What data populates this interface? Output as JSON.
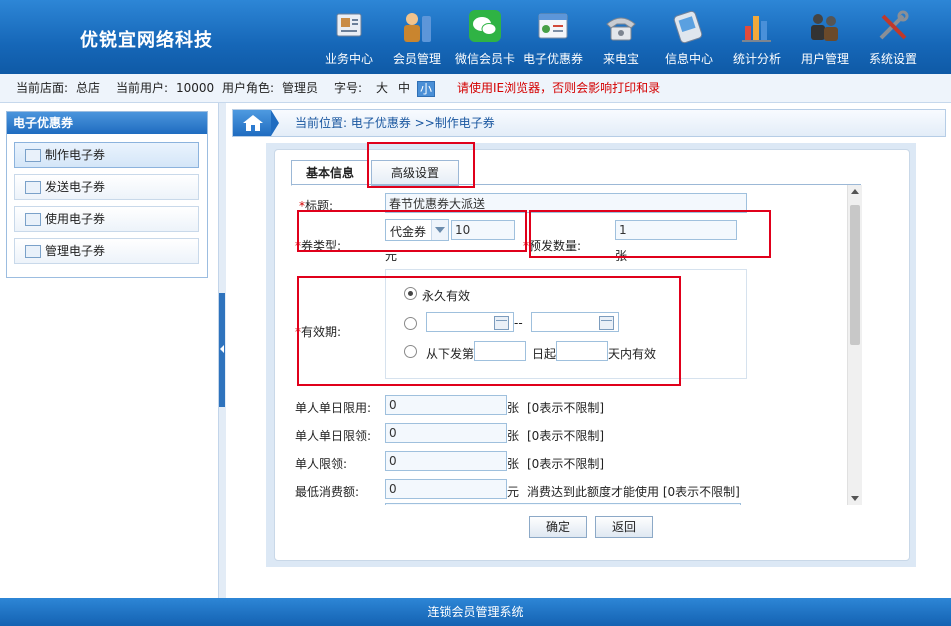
{
  "header": {
    "brand": "优锐宜网络科技",
    "nav": [
      {
        "label": "业务中心",
        "icon": "business-center-icon"
      },
      {
        "label": "会员管理",
        "icon": "member-management-icon"
      },
      {
        "label": "微信会员卡",
        "icon": "wechat-icon"
      },
      {
        "label": "电子优惠券",
        "icon": "coupon-icon"
      },
      {
        "label": "来电宝",
        "icon": "phone-icon"
      },
      {
        "label": "信息中心",
        "icon": "info-center-icon"
      },
      {
        "label": "统计分析",
        "icon": "statistics-icon"
      },
      {
        "label": "用户管理",
        "icon": "user-management-icon"
      },
      {
        "label": "系统设置",
        "icon": "system-settings-icon"
      }
    ]
  },
  "infobar": {
    "store_label": "当前店面:",
    "store_value": "总店",
    "user_label": "当前用户:",
    "user_value": "10000",
    "role_label": "用户角色:",
    "role_value": "管理员",
    "fontsize_label": "字号:",
    "fontsize_large": "大",
    "fontsize_medium": "中",
    "fontsize_small": "小",
    "warning": "请使用IE浏览器，否则会影响打印和录"
  },
  "sidebar": {
    "title": "电子优惠券",
    "items": [
      {
        "label": "制作电子券"
      },
      {
        "label": "发送电子券"
      },
      {
        "label": "使用电子券"
      },
      {
        "label": "管理电子券"
      }
    ]
  },
  "breadcrumb": {
    "text": "当前位置: 电子优惠券 >>制作电子券"
  },
  "tabs": {
    "basic": "基本信息",
    "advanced": "高级设置"
  },
  "form": {
    "title_label": "标题:",
    "title_value": "春节优惠券大派送",
    "type_label": "券类型:",
    "type_value": "代金券",
    "amount_value": "10",
    "amount_unit": "元",
    "qty_label": "预发数量:",
    "qty_value": "1",
    "qty_unit": "张",
    "valid_label": "有效期:",
    "valid_forever": "永久有效",
    "date_sep": "--",
    "valid_from": "从下发第",
    "valid_day_start": "日起",
    "valid_days": "天内有效",
    "daily_use_label": "单人单日限用:",
    "daily_use_value": "0",
    "daily_get_label": "单人单日限领:",
    "daily_get_value": "0",
    "per_get_label": "单人限领:",
    "per_get_value": "0",
    "min_spend_label": "最低消费额:",
    "min_spend_value": "0",
    "unit_zhang": "张",
    "unit_yuan": "元",
    "hint_unlimited": "[0表示不限制]",
    "min_spend_hint": "消费达到此额度才能使用 [0表示不限制]",
    "required_mark": "*"
  },
  "buttons": {
    "ok": "确定",
    "back": "返回"
  },
  "footer": {
    "text": "连锁会员管理系统"
  },
  "colors": {
    "header_blue": "#1667b8",
    "highlight_red": "#e0001b",
    "warning_red": "#d40000"
  }
}
